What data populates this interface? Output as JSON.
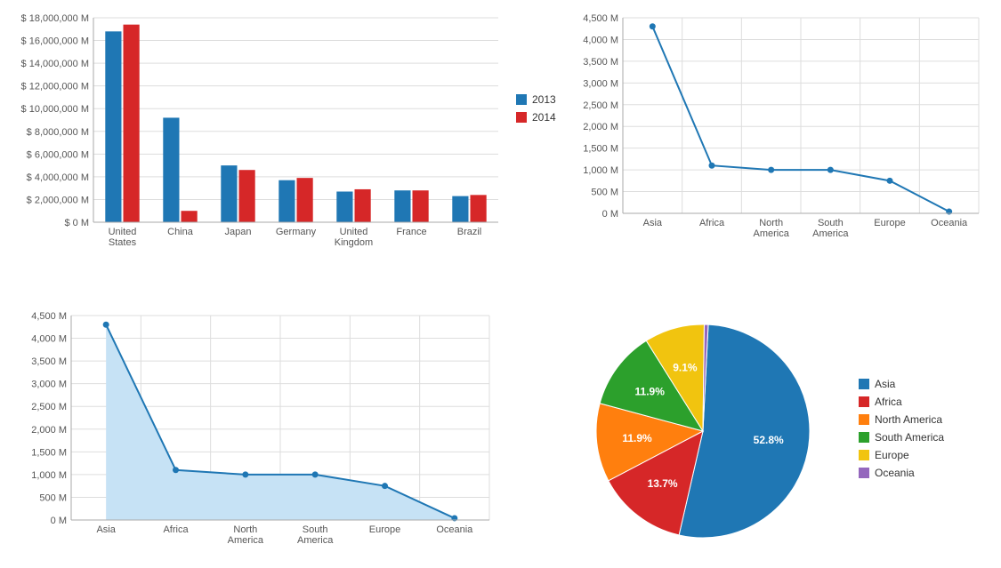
{
  "colors": {
    "blue": "#1f77b4",
    "red": "#d62728",
    "orange": "#ff7f0e",
    "green": "#2ca02c",
    "yellow": "#f1c40f",
    "purple": "#9467bd",
    "grid": "#dddddd",
    "axis": "#aaaaaa",
    "areaFill": "#c6e2f5"
  },
  "chart_data": [
    {
      "id": "bar",
      "type": "bar",
      "categories": [
        "United States",
        "China",
        "Japan",
        "Germany",
        "United Kingdom",
        "France",
        "Brazil"
      ],
      "series": [
        {
          "name": "2013",
          "values": [
            16800000,
            9200000,
            5000000,
            3700000,
            2700000,
            2800000,
            2300000
          ],
          "color_key": "blue"
        },
        {
          "name": "2014",
          "values": [
            17400000,
            1000000,
            4600000,
            3900000,
            2900000,
            2800000,
            2400000
          ],
          "color_key": "red"
        }
      ],
      "ylim": [
        0,
        18000000
      ],
      "yticks": [
        0,
        2000000,
        4000000,
        6000000,
        8000000,
        10000000,
        12000000,
        14000000,
        16000000,
        18000000
      ],
      "ytick_labels": [
        "$ 0 M",
        "$ 2,000,000 M",
        "$ 4,000,000 M",
        "$ 6,000,000 M",
        "$ 8,000,000 M",
        "$ 10,000,000 M",
        "$ 12,000,000 M",
        "$ 14,000,000 M",
        "$ 16,000,000 M",
        "$ 18,000,000 M"
      ],
      "legend": [
        "2013",
        "2014"
      ]
    },
    {
      "id": "line",
      "type": "line",
      "categories": [
        "Asia",
        "Africa",
        "North America",
        "South America",
        "Europe",
        "Oceania"
      ],
      "values": [
        4300,
        1100,
        1000,
        1000,
        750,
        40
      ],
      "ylim": [
        0,
        4500
      ],
      "yticks": [
        0,
        500,
        1000,
        1500,
        2000,
        2500,
        3000,
        3500,
        4000,
        4500
      ],
      "ytick_labels": [
        "0 M",
        "500 M",
        "1,000 M",
        "1,500 M",
        "2,000 M",
        "2,500 M",
        "3,000 M",
        "3,500 M",
        "4,000 M",
        "4,500 M"
      ],
      "color_key": "blue"
    },
    {
      "id": "area",
      "type": "area",
      "categories": [
        "Asia",
        "Africa",
        "North America",
        "South America",
        "Europe",
        "Oceania"
      ],
      "values": [
        4300,
        1100,
        1000,
        1000,
        750,
        40
      ],
      "ylim": [
        0,
        4500
      ],
      "yticks": [
        0,
        500,
        1000,
        1500,
        2000,
        2500,
        3000,
        3500,
        4000,
        4500
      ],
      "ytick_labels": [
        "0 M",
        "500 M",
        "1,000 M",
        "1,500 M",
        "2,000 M",
        "2,500 M",
        "3,000 M",
        "3,500 M",
        "4,000 M",
        "4,500 M"
      ],
      "color_key": "blue",
      "fill_key": "areaFill"
    },
    {
      "id": "pie",
      "type": "pie",
      "slices": [
        {
          "name": "Asia",
          "value": 52.8,
          "label": "52.8%",
          "color_key": "blue"
        },
        {
          "name": "Africa",
          "value": 13.7,
          "label": "13.7%",
          "color_key": "red"
        },
        {
          "name": "North America",
          "value": 11.9,
          "label": "11.9%",
          "color_key": "orange"
        },
        {
          "name": "South America",
          "value": 11.9,
          "label": "11.9%",
          "color_key": "green"
        },
        {
          "name": "Europe",
          "value": 9.1,
          "label": "9.1%",
          "color_key": "yellow"
        },
        {
          "name": "Oceania",
          "value": 0.6,
          "label": "",
          "color_key": "purple"
        }
      ],
      "legend": [
        "Asia",
        "Africa",
        "North America",
        "South America",
        "Europe",
        "Oceania"
      ]
    }
  ]
}
